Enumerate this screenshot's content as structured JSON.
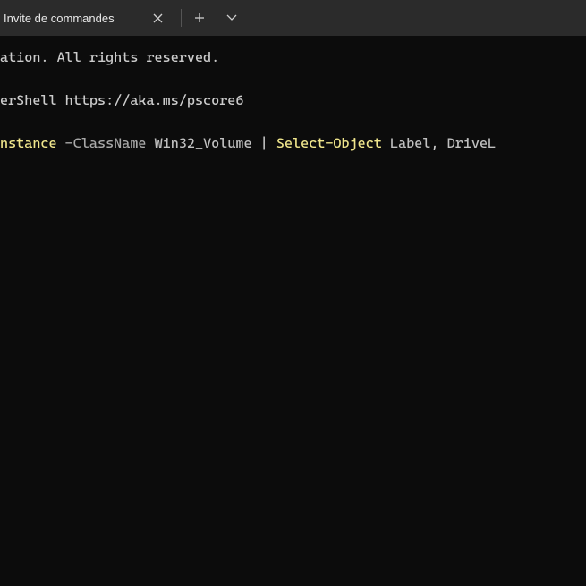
{
  "titlebar": {
    "tab": {
      "title": "Invite de commandes"
    },
    "new_tab_label": "+",
    "dropdown_label": "⌄",
    "close_label": "×"
  },
  "terminal": {
    "lines": [
      {
        "type": "plain",
        "text": "ation. All rights reserved."
      },
      {
        "type": "blank",
        "text": ""
      },
      {
        "type": "plain",
        "text": "erShell https://aka.ms/pscore6"
      },
      {
        "type": "blank",
        "text": ""
      },
      {
        "type": "tokens",
        "tokens": [
          {
            "cls": "tok-cmd",
            "text": "nstance"
          },
          {
            "cls": "tok-plain",
            "text": " "
          },
          {
            "cls": "tok-param",
            "text": "-ClassName"
          },
          {
            "cls": "tok-plain",
            "text": " "
          },
          {
            "cls": "tok-arg",
            "text": "Win32_Volume"
          },
          {
            "cls": "tok-plain",
            "text": " "
          },
          {
            "cls": "tok-pipe",
            "text": "|"
          },
          {
            "cls": "tok-plain",
            "text": " "
          },
          {
            "cls": "tok-cmd",
            "text": "Select-Object"
          },
          {
            "cls": "tok-plain",
            "text": " "
          },
          {
            "cls": "tok-arg",
            "text": "Label"
          },
          {
            "cls": "tok-plain",
            "text": ", "
          },
          {
            "cls": "tok-arg",
            "text": "DriveL"
          }
        ]
      }
    ]
  }
}
